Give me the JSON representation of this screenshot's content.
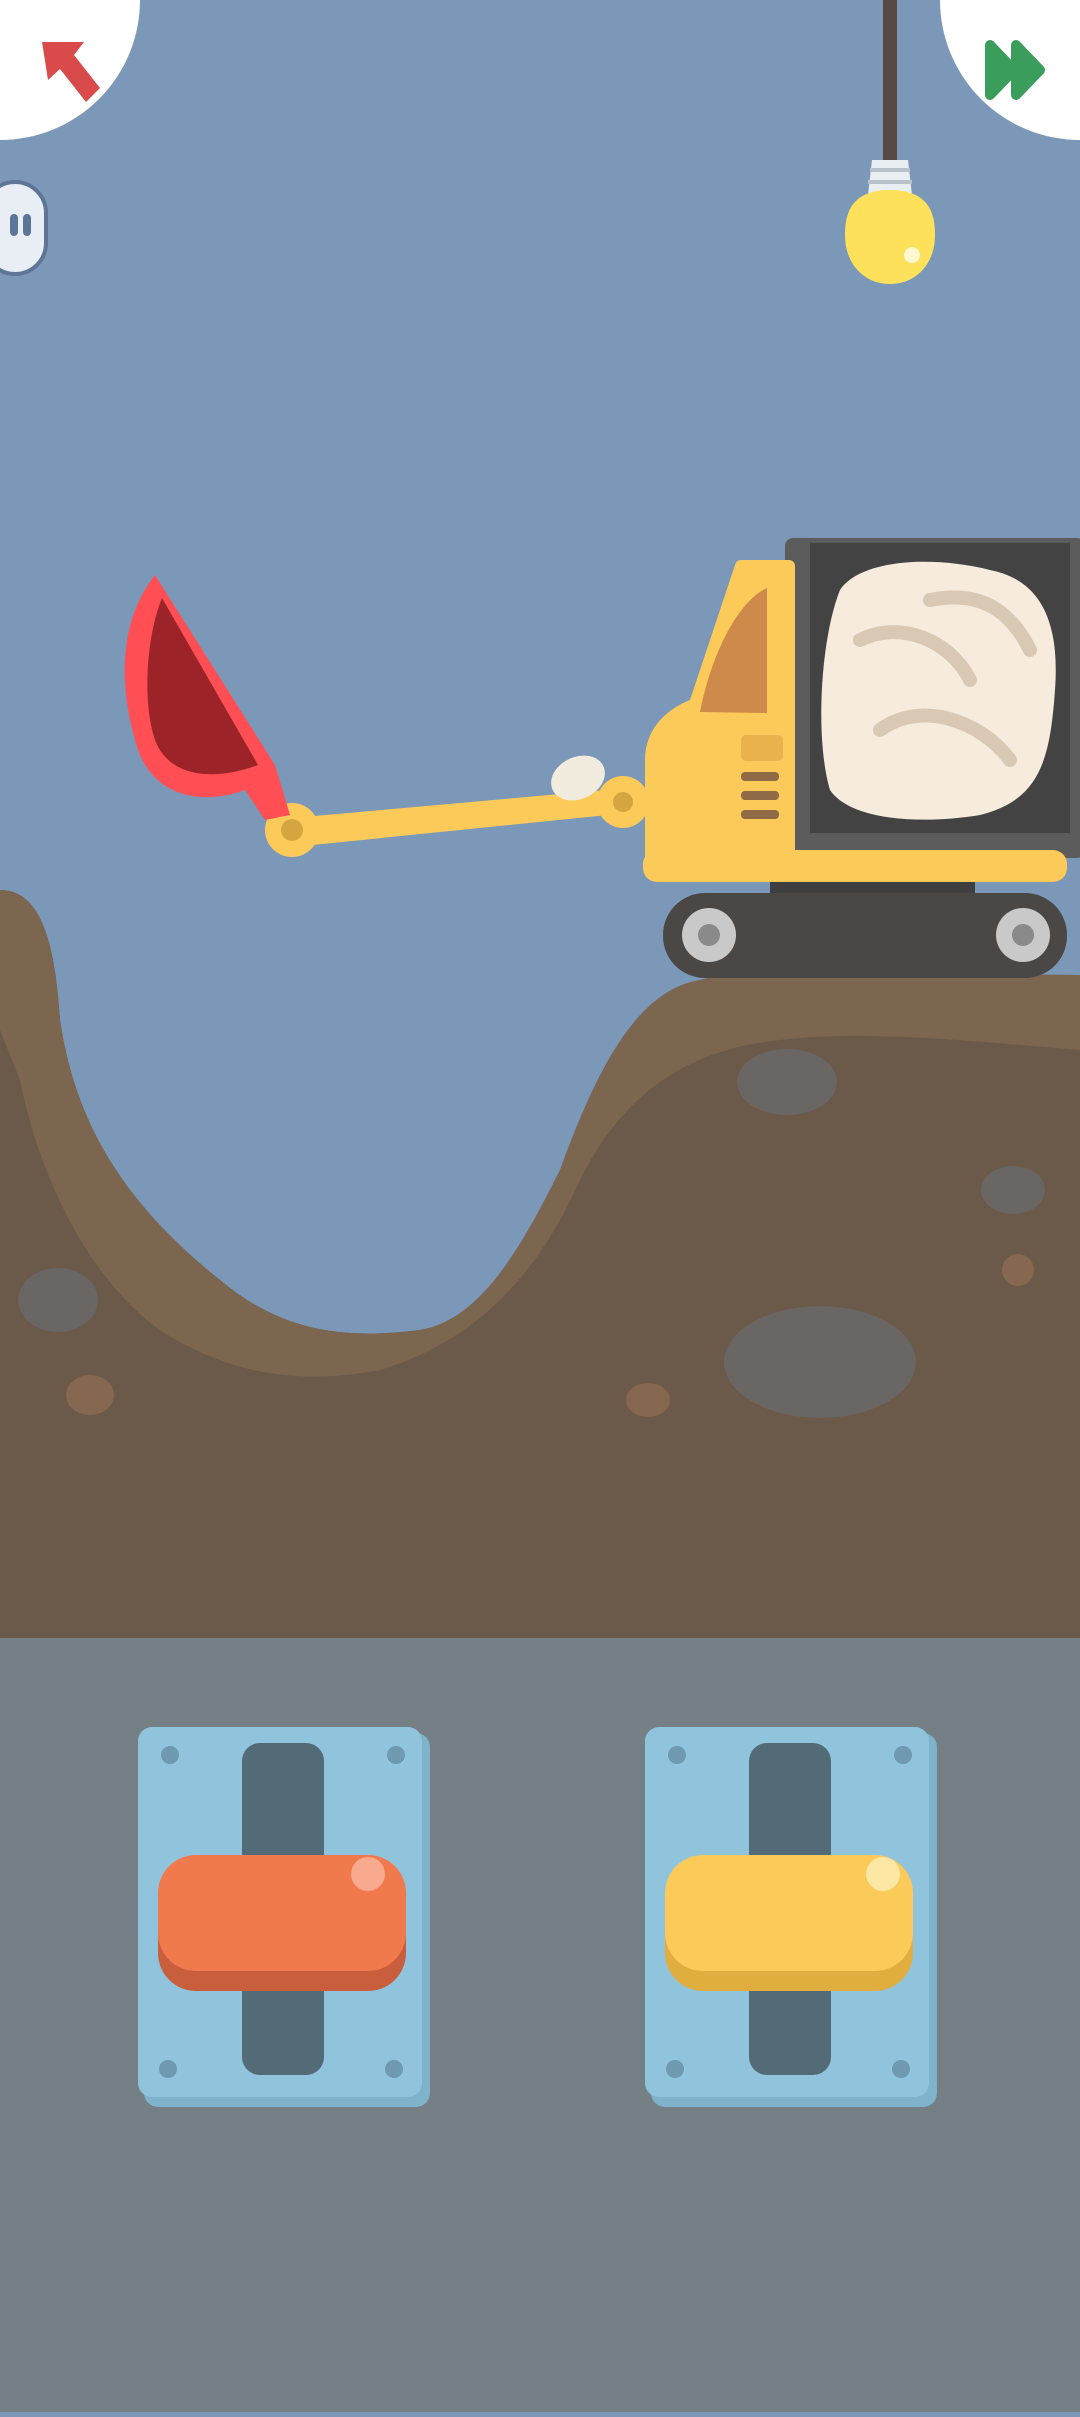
{
  "screen": {
    "name": "excavator-dig-level"
  },
  "toolbar": {
    "back_icon": "arrow-up-left-icon",
    "skip_icon": "fast-forward-icon",
    "pause_icon": "pause-icon"
  },
  "controls": [
    {
      "name": "arm-lever",
      "color": "#f07a4d",
      "position": 0.5
    },
    {
      "name": "bucket-lever",
      "color": "#fcca58",
      "position": 0.5
    }
  ],
  "colors": {
    "sky": "#7b98b9",
    "ground": "#6b5a49",
    "ground_top": "#7d6650",
    "control_bg": "#747f86",
    "excavator": "#fcca58",
    "bucket": "#ff4f55",
    "bucket_inner": "#9c2429",
    "back_arrow": "#d94b4b",
    "skip_arrows": "#3a9d5c",
    "panel": "#8fc4dc"
  }
}
